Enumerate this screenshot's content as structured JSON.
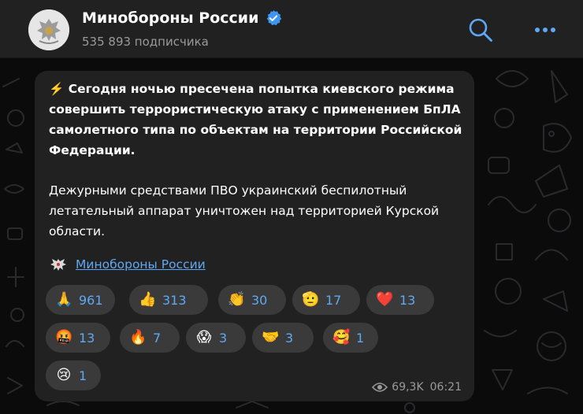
{
  "channel": {
    "name": "Минобороны России",
    "subscribers": "535 893 подписчика"
  },
  "message": {
    "bold_text": "⚡️ Сегодня ночью пресечена попытка киевского режима совершить террористическую атаку с применением БпЛА самолетного типа по объектам на территории Российской Федерации.",
    "text": "Дежурными средствами ПВО украинский беспилотный летательный аппарат уничтожен над территорией Курской области.",
    "signature": "Минобороны России",
    "views": "69,3K",
    "time": "06:21"
  },
  "reactions": [
    {
      "emoji": "🙏",
      "count": "961"
    },
    {
      "emoji": "👍",
      "count": "313"
    },
    {
      "emoji": "👏",
      "count": "30"
    },
    {
      "emoji": "🫡",
      "count": "17"
    },
    {
      "emoji": "❤️",
      "count": "13"
    },
    {
      "emoji": "🤬",
      "count": "13"
    },
    {
      "emoji": "🔥",
      "count": "7"
    },
    {
      "emoji": "😱",
      "count": "3"
    },
    {
      "emoji": "🤝",
      "count": "3"
    },
    {
      "emoji": "🥰",
      "count": "1"
    },
    {
      "emoji": "😢",
      "count": "1"
    }
  ],
  "colors": {
    "accent": "#5fa8f3",
    "header_bg": "#212121",
    "bubble_bg": "#212121",
    "reaction_bg": "#3a3a3a",
    "verified": "#3d96f0"
  },
  "icons": {
    "search": "search-icon",
    "more": "more-icon",
    "verified": "verified-icon",
    "views": "eye-icon"
  }
}
